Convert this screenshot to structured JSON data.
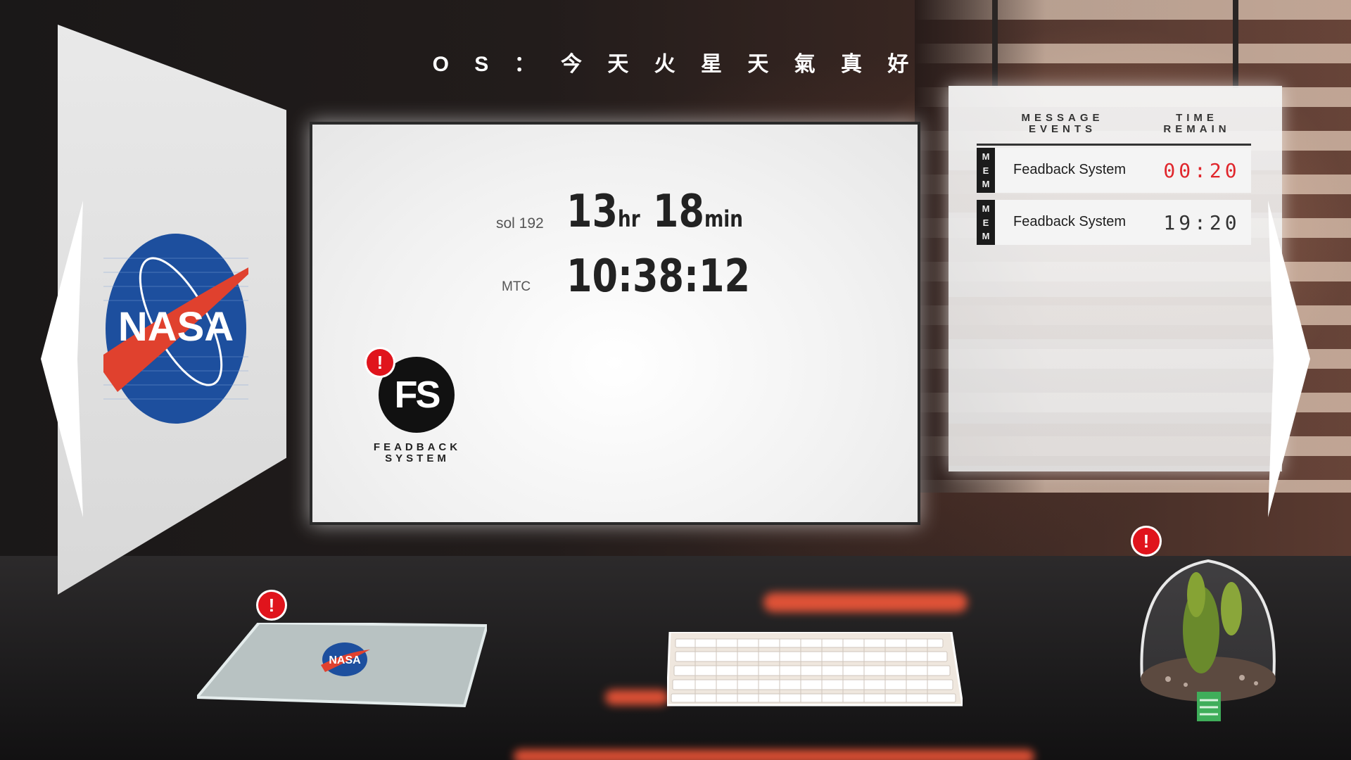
{
  "header": {
    "os_message": "O S ： 今 天 火 星 天 氣 真 好"
  },
  "monitor": {
    "sol_label": "sol 192",
    "sol_hours": "13",
    "hours_unit": "hr",
    "sol_minutes": "18",
    "minutes_unit": "min",
    "mtc_label": "MTC",
    "mtc_time": "10:38:12"
  },
  "fs_app": {
    "icon_text": "FS",
    "caption_line1": "FEADBACK",
    "caption_line2": "SYSTEM",
    "alert": "!"
  },
  "left_panel": {
    "logo_text": "NASA"
  },
  "message_board": {
    "col_events_line1": "MESSAGE",
    "col_events_line2": "EVENTS",
    "col_time_line1": "TIME",
    "col_time_line2": "REMAIN",
    "rows": [
      {
        "tag": [
          "M",
          "E",
          "M"
        ],
        "event": "Feadback System",
        "time": "00:20",
        "urgent": true
      },
      {
        "tag": [
          "M",
          "E",
          "M"
        ],
        "event": "Feadback System",
        "time": "19:20",
        "urgent": false
      }
    ]
  },
  "desk_items": {
    "laptop_logo": "NASA",
    "laptop_alert": "!",
    "terrarium_alert": "!"
  },
  "colors": {
    "alert": "#e0141c",
    "urgent_time": "#e0262c",
    "desk_glow": "#ff5a3a"
  },
  "icons": [
    "chevron-left-icon",
    "chevron-right-icon",
    "alert-icon",
    "nasa-logo",
    "fs-logo"
  ]
}
